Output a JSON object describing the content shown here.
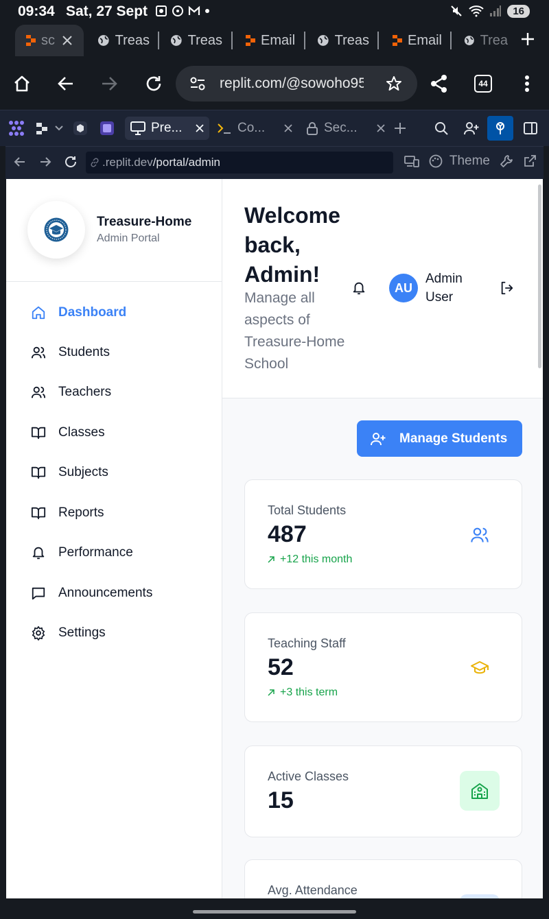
{
  "status_bar": {
    "time": "09:34",
    "date": "Sat, 27 Sept",
    "battery": "16"
  },
  "browser": {
    "tabs": [
      {
        "label": "sc",
        "icon": "replit-icon"
      },
      {
        "label": "Treas",
        "icon": "globe-icon"
      },
      {
        "label": "Treas",
        "icon": "globe-icon"
      },
      {
        "label": "Email",
        "icon": "replit-icon"
      },
      {
        "label": "Treas",
        "icon": "globe-icon"
      },
      {
        "label": "Email",
        "icon": "replit-icon"
      },
      {
        "label": "Trea",
        "icon": "globe-icon"
      }
    ],
    "url": "replit.com/@sowoho95",
    "tab_count": "44"
  },
  "replit": {
    "tabs": [
      {
        "label": "Pre...",
        "icon": "monitor-icon"
      },
      {
        "label": "Co...",
        "icon": "terminal-icon"
      },
      {
        "label": "Sec...",
        "icon": "lock-icon"
      }
    ],
    "preview_url_host": ".replit.dev",
    "preview_url_path": "/portal/admin",
    "theme_label": "Theme"
  },
  "sidebar": {
    "school_name": "Treasure-Home",
    "portal_label": "Admin Portal",
    "items": [
      {
        "label": "Dashboard",
        "icon": "home-icon",
        "active": true
      },
      {
        "label": "Students",
        "icon": "users-icon"
      },
      {
        "label": "Teachers",
        "icon": "users-icon"
      },
      {
        "label": "Classes",
        "icon": "book-icon"
      },
      {
        "label": "Subjects",
        "icon": "book-icon"
      },
      {
        "label": "Reports",
        "icon": "book-icon"
      },
      {
        "label": "Performance",
        "icon": "bell-icon"
      },
      {
        "label": "Announcements",
        "icon": "message-icon"
      },
      {
        "label": "Settings",
        "icon": "gear-icon"
      }
    ]
  },
  "header": {
    "title": "Welcome back, Admin!",
    "subtitle": "Manage all aspects of Treasure-Home School",
    "avatar_initials": "AU",
    "user_name": "Admin User"
  },
  "main": {
    "manage_button": "Manage Students",
    "cards": [
      {
        "label": "Total Students",
        "value": "487",
        "trend": "+12 this month",
        "icon": "users-icon",
        "icon_color": "#3b82f6"
      },
      {
        "label": "Teaching Staff",
        "value": "52",
        "trend": "+3 this term",
        "icon": "graduation-cap-icon",
        "icon_color": "#eab308"
      },
      {
        "label": "Active Classes",
        "value": "15",
        "icon": "school-icon",
        "icon_color": "#16a34a"
      },
      {
        "label": "Avg. Attendance"
      }
    ]
  },
  "colors": {
    "primary": "#3b82f6",
    "success": "#16a34a",
    "warning": "#eab308"
  }
}
